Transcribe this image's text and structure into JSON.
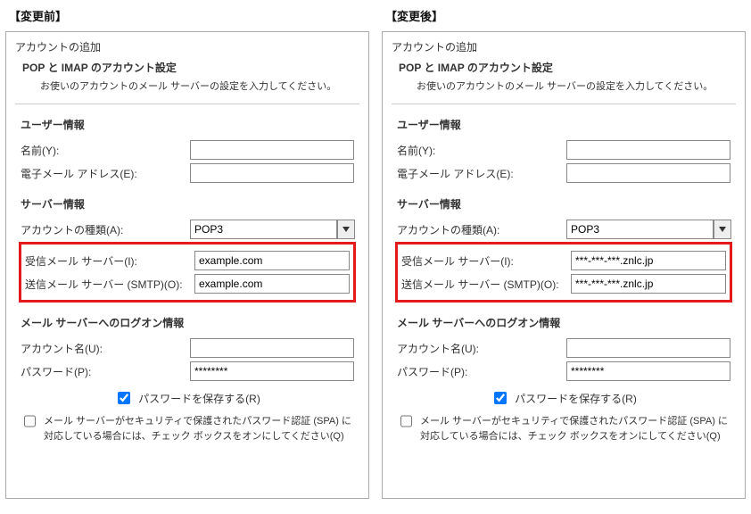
{
  "panels": {
    "before": {
      "title": "【変更前】",
      "dlg_title": "アカウントの追加",
      "header_h1": "POP と IMAP のアカウント設定",
      "header_h2": "お使いのアカウントのメール サーバーの設定を入力してください。",
      "section_user": "ユーザー情報",
      "label_name": "名前(Y):",
      "label_email": "電子メール アドレス(E):",
      "value_name": "",
      "value_email": "",
      "section_server": "サーバー情報",
      "label_acct_type": "アカウントの種類(A):",
      "value_acct_type": "POP3",
      "label_incoming": "受信メール サーバー(I):",
      "value_incoming": "example.com",
      "label_outgoing": "送信メール サーバー (SMTP)(O):",
      "value_outgoing": "example.com",
      "section_logon": "メール サーバーへのログオン情報",
      "label_acct_name": "アカウント名(U):",
      "value_acct_name": "",
      "label_password": "パスワード(P):",
      "value_password": "********",
      "label_save_pw": "パスワードを保存する(R)",
      "save_pw_checked": true,
      "label_spa": "メール サーバーがセキュリティで保護されたパスワード認証 (SPA) に対応している場合には、チェック ボックスをオンにしてください(Q)",
      "spa_checked": false
    },
    "after": {
      "title": "【変更後】",
      "dlg_title": "アカウントの追加",
      "header_h1": "POP と IMAP のアカウント設定",
      "header_h2": "お使いのアカウントのメール サーバーの設定を入力してください。",
      "section_user": "ユーザー情報",
      "label_name": "名前(Y):",
      "label_email": "電子メール アドレス(E):",
      "value_name": "",
      "value_email": "",
      "section_server": "サーバー情報",
      "label_acct_type": "アカウントの種類(A):",
      "value_acct_type": "POP3",
      "label_incoming": "受信メール サーバー(I):",
      "value_incoming": "***-***-***.znlc.jp",
      "label_outgoing": "送信メール サーバー (SMTP)(O):",
      "value_outgoing": "***-***-***.znlc.jp",
      "section_logon": "メール サーバーへのログオン情報",
      "label_acct_name": "アカウント名(U):",
      "value_acct_name": "",
      "label_password": "パスワード(P):",
      "value_password": "********",
      "label_save_pw": "パスワードを保存する(R)",
      "save_pw_checked": true,
      "label_spa": "メール サーバーがセキュリティで保護されたパスワード認証 (SPA) に対応している場合には、チェック ボックスをオンにしてください(Q)",
      "spa_checked": false
    }
  }
}
